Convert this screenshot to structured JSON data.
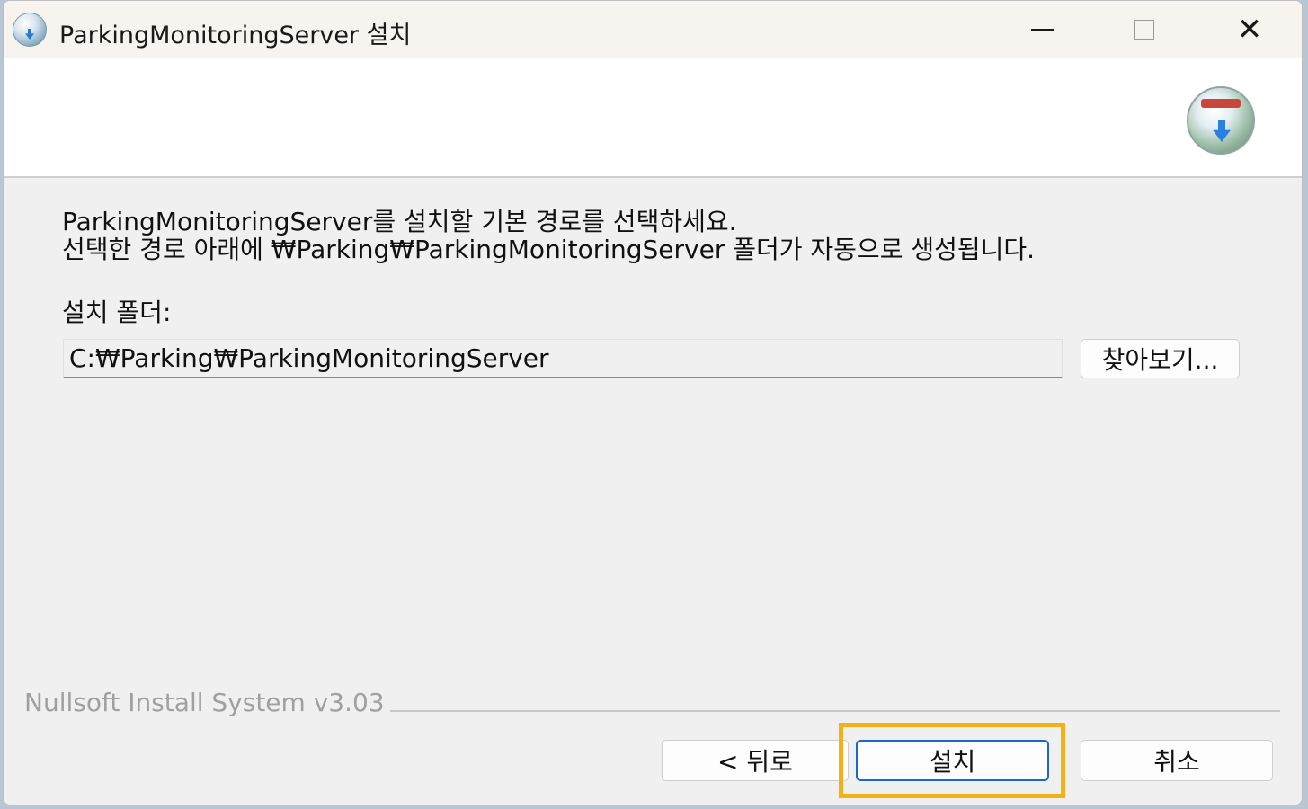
{
  "window": {
    "title": "ParkingMonitoringServer 설치",
    "controls": {
      "minimize": "minimize-icon",
      "maximize": "maximize-icon",
      "close": "close-icon"
    }
  },
  "header": {
    "logo": "installer-logo-icon"
  },
  "content": {
    "description_line1": "ParkingMonitoringServer를 설치할 기본 경로를 선택하세요.",
    "description_line2": "선택한 경로 아래에 ₩Parking₩ParkingMonitoringServer 폴더가 자동으로 생성됩니다.",
    "folder_label": "설치 폴더:",
    "folder_path": "C:₩Parking₩ParkingMonitoringServer",
    "browse_label": "찾아보기..."
  },
  "footer": {
    "branding": "Nullsoft Install System v3.03",
    "back_label": "< 뒤로",
    "install_label": "설치",
    "cancel_label": "취소"
  },
  "colors": {
    "highlight": "#f5b015",
    "default_button_border": "#1c67c9"
  }
}
